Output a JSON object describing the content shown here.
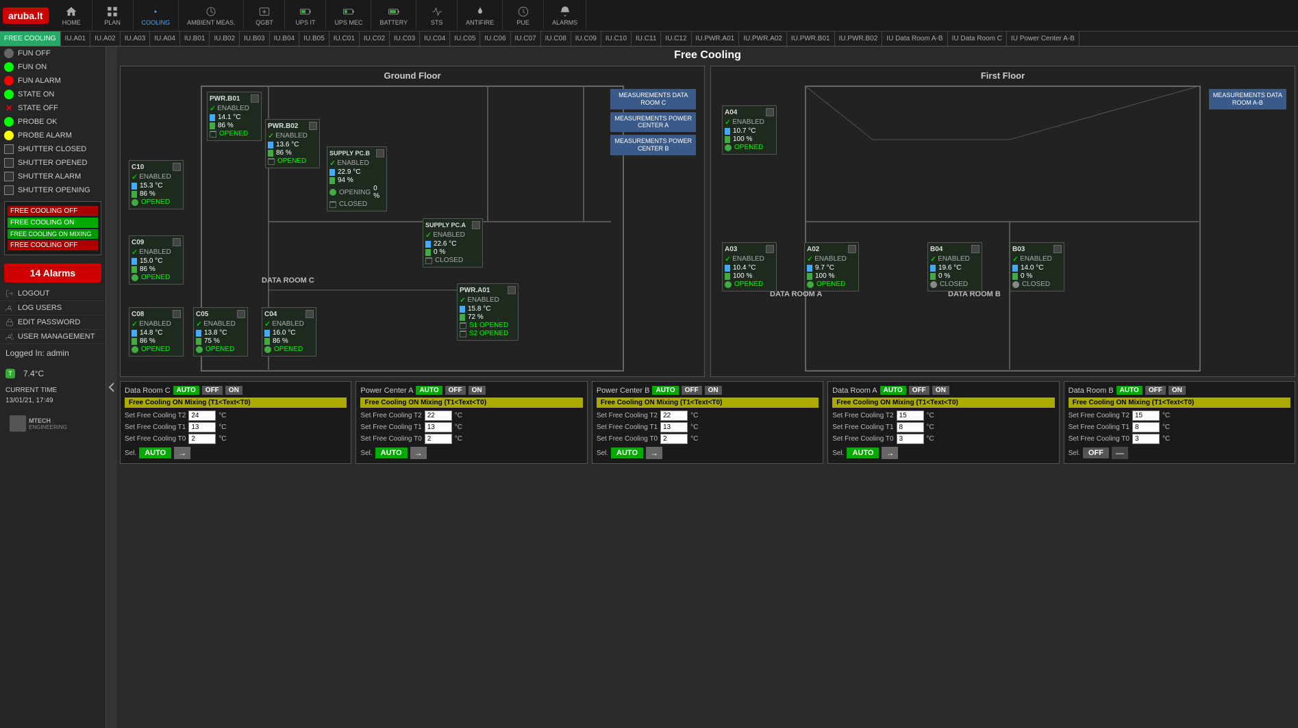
{
  "logo": "aruba.lt",
  "nav": {
    "items": [
      {
        "id": "home",
        "label": "HOME",
        "icon": "home"
      },
      {
        "id": "plan",
        "label": "PLAN",
        "icon": "grid"
      },
      {
        "id": "cooling",
        "label": "COOLING",
        "icon": "snowflake",
        "active": true
      },
      {
        "id": "ambient",
        "label": "AMBIENT MEAS.",
        "icon": "thermometer"
      },
      {
        "id": "qgbt",
        "label": "QGBT",
        "icon": "power"
      },
      {
        "id": "upsit",
        "label": "UPS IT",
        "icon": "battery"
      },
      {
        "id": "upsmec",
        "label": "UPS MEC",
        "icon": "battery"
      },
      {
        "id": "battery",
        "label": "BATTERY",
        "icon": "battery"
      },
      {
        "id": "sts",
        "label": "STS",
        "icon": "sts"
      },
      {
        "id": "antifire",
        "label": "ANTIFIRE",
        "icon": "fire"
      },
      {
        "id": "pue",
        "label": "PUE",
        "icon": "pue"
      },
      {
        "id": "alarms",
        "label": "ALARMS",
        "icon": "bell"
      }
    ]
  },
  "sub_nav": {
    "items": [
      "FREE COOLING",
      "IU.A01",
      "IU.A02",
      "IU.A03",
      "IU.A04",
      "IU.B01",
      "IU.B02",
      "IU.B03",
      "IU.B04",
      "IU.B05",
      "IU.C01",
      "IU.C02",
      "IU.C03",
      "IU.C04",
      "IU.C05",
      "IU.C06",
      "IU.C07",
      "IU.C08",
      "IU.C09",
      "IU.C10",
      "IU.C11",
      "IU.C12",
      "IU.PWR.A01",
      "IU.PWR.A02",
      "IU.PWR.B01",
      "IU.PWR.B02",
      "IU Data Room A-B",
      "IU Data Room C",
      "IU Power Center A-B"
    ],
    "active": "FREE COOLING"
  },
  "page_title": "Free Cooling",
  "sidebar": {
    "indicators": [
      {
        "label": "FUN OFF",
        "type": "dot-gray"
      },
      {
        "label": "FUN ON",
        "type": "dot-green"
      },
      {
        "label": "FUN ALARM",
        "type": "dot-red"
      },
      {
        "label": "STATE ON",
        "type": "dot-green"
      },
      {
        "label": "STATE OFF",
        "type": "dot-x"
      },
      {
        "label": "PROBE OK",
        "type": "dot-green"
      },
      {
        "label": "PROBE ALARM",
        "type": "dot-yellow"
      },
      {
        "label": "SHUTTER CLOSED",
        "type": "dot-square"
      },
      {
        "label": "SHUTTER OPENED",
        "type": "dot-square"
      },
      {
        "label": "SHUTTER ALARM",
        "type": "dot-square"
      },
      {
        "label": "SHUTTER OPENING",
        "type": "dot-square"
      }
    ],
    "legend": [
      {
        "label": "FREE COOLING OFF",
        "class": "legend-off"
      },
      {
        "label": "FREE COOLING ON",
        "class": "legend-on"
      },
      {
        "label": "FREE COOLING ON MIXING",
        "class": "legend-mixing"
      },
      {
        "label": "FREE COOLING OFF",
        "class": "legend-off2"
      }
    ],
    "alarms_count": "14 Alarms",
    "actions": [
      {
        "label": "LOGOUT"
      },
      {
        "label": "LOG USERS"
      },
      {
        "label": "EDIT PASSWORD"
      },
      {
        "label": "USER MANAGEMENT"
      }
    ],
    "logged_in": "Logged In: admin",
    "temperature": "7.4°C",
    "current_time_label": "CURRENT TIME",
    "current_time": "13/01/21, 17:49"
  },
  "ground_floor": {
    "title": "Ground Floor",
    "meas_buttons": [
      "MEASUREMENTS DATA\nROOM C",
      "MEASUREMENTS POWER\nCENTER A",
      "MEASUREMENTS POWER\nCENTER B"
    ],
    "rooms": [
      "DATA ROOM C"
    ],
    "units": {
      "pwrb01": {
        "name": "PWR.B01",
        "enabled": "ENABLED",
        "temp": "14.1 °C",
        "percent": "86 %",
        "status": "OPENED"
      },
      "pwrb02": {
        "name": "PWR.B02",
        "enabled": "ENABLED",
        "temp": "13.6 °C",
        "percent": "86 %",
        "status": "OPENED"
      },
      "supplypcb": {
        "name": "SUPPLY PC.B",
        "enabled": "ENABLED",
        "temp": "22.9 °C",
        "percent": "94 %",
        "opening": "OPENING",
        "opening_val": "0 %",
        "status": "CLOSED"
      },
      "supplyPCA": {
        "name": "SUPPLY PC.A",
        "enabled": "ENABLED",
        "temp": "22.6 °C",
        "percent": "0 %",
        "status": "CLOSED"
      },
      "pwra01": {
        "name": "PWR.A01",
        "enabled": "ENABLED",
        "temp": "15.8 °C",
        "percent": "72 %",
        "s1": "S1 OPENED",
        "s2": "S2 OPENED"
      },
      "c10": {
        "name": "C10",
        "enabled": "ENABLED",
        "temp": "15.3 °C",
        "percent": "86 %",
        "status": "OPENED"
      },
      "c09": {
        "name": "C09",
        "enabled": "ENABLED",
        "temp": "15.0 °C",
        "percent": "86 %",
        "status": "OPENED"
      },
      "c08": {
        "name": "C08",
        "enabled": "ENABLED",
        "temp": "14.8 °C",
        "percent": "86 %",
        "status": "OPENED"
      },
      "c05": {
        "name": "C05",
        "enabled": "ENABLED",
        "temp": "13.8 °C",
        "percent": "75 %",
        "status": "OPENED"
      },
      "c04": {
        "name": "C04",
        "enabled": "ENABLED",
        "temp": "16.0 °C",
        "percent": "86 %",
        "status": "OPENED"
      }
    }
  },
  "first_floor": {
    "title": "First Floor",
    "meas_buttons": [
      "MEASUREMENTS DATA\nROOM A-B"
    ],
    "rooms": [
      "DATA ROOM A",
      "DATA ROOM B"
    ],
    "units": {
      "a04": {
        "name": "A04",
        "enabled": "ENABLED",
        "temp": "10.7 °C",
        "percent": "100 %",
        "status": "OPENED"
      },
      "a03": {
        "name": "A03",
        "enabled": "ENABLED",
        "temp": "10.4 °C",
        "percent": "100 %",
        "status": "OPENED"
      },
      "a02": {
        "name": "A02",
        "enabled": "ENABLED",
        "temp": "9.7 °C",
        "percent": "100 %",
        "status": "OPENED"
      },
      "b04": {
        "name": "B04",
        "enabled": "ENABLED",
        "temp": "19.6 °C",
        "percent": "0 %",
        "status": "CLOSED"
      },
      "b03": {
        "name": "B03",
        "enabled": "ENABLED",
        "temp": "14.0 °C",
        "percent": "0 %",
        "status": "CLOSED"
      }
    }
  },
  "ctrl_panels": [
    {
      "id": "data_room_c",
      "label": "Data Room C",
      "mode": "AUTO",
      "status_text": "Free Cooling ON Mixing (T1<Text<T0)",
      "t2": "24",
      "t1": "13",
      "t0": "2",
      "sel_mode": "AUTO"
    },
    {
      "id": "power_center_a",
      "label": "Power Center A",
      "mode": "AUTO",
      "status_text": "Free Cooling ON Mixing (T1<Text<T0)",
      "t2": "22",
      "t1": "13",
      "t0": "2",
      "sel_mode": "AUTO"
    },
    {
      "id": "power_center_b",
      "label": "Power Center B",
      "mode": "AUTO",
      "status_text": "Free Cooling ON Mixing (T1<Text<T0)",
      "t2": "22",
      "t1": "13",
      "t0": "2",
      "sel_mode": "AUTO"
    },
    {
      "id": "data_room_a",
      "label": "Data Room A",
      "mode": "AUTO",
      "status_text": "Free Cooling ON Mixing (T1<Text<T0)",
      "t2": "15",
      "t1": "8",
      "t0": "3",
      "sel_mode": "AUTO"
    },
    {
      "id": "data_room_b",
      "label": "Data Room B",
      "mode": "AUTO",
      "status_text": "Free Cooling ON Mixing (T1<Text<T0)",
      "t2": "15",
      "t1": "8",
      "t0": "3",
      "sel_mode": "OFF"
    }
  ],
  "labels": {
    "set_free_cooling_t2": "Set Free Cooling T2",
    "set_free_cooling_t1": "Set Free Cooling T1",
    "set_free_cooling_t0": "Set Free Cooling T0",
    "sel": "Sel.",
    "deg_c": "°C",
    "auto": "AUTO",
    "off": "OFF",
    "on": "ON"
  }
}
